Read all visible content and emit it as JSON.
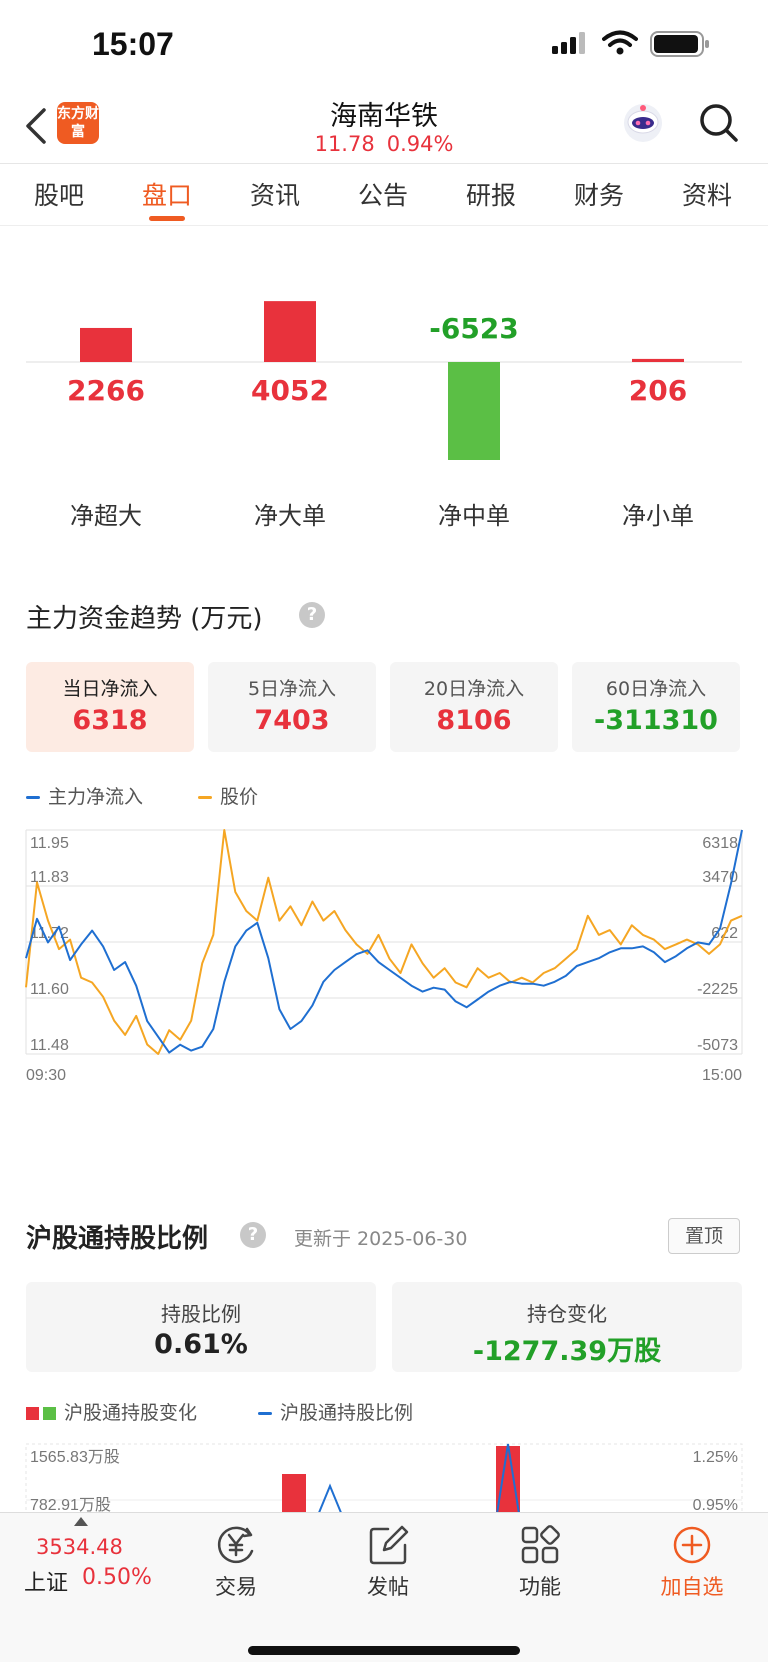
{
  "status_bar": {
    "time": "15:07"
  },
  "header": {
    "logo_text": "东方财富",
    "stock_name": "海南华铁",
    "price": "11.78",
    "change_pct": "0.94%"
  },
  "tabs": [
    {
      "label": "股吧",
      "active": false
    },
    {
      "label": "盘口",
      "active": true
    },
    {
      "label": "资讯",
      "active": false
    },
    {
      "label": "公告",
      "active": false
    },
    {
      "label": "研报",
      "active": false
    },
    {
      "label": "财务",
      "active": false
    },
    {
      "label": "资料",
      "active": false
    }
  ],
  "order_flow": [
    {
      "label": "净超大",
      "value": "2266",
      "amount": 2266
    },
    {
      "label": "净大单",
      "value": "4052",
      "amount": 4052
    },
    {
      "label": "净中单",
      "value": "-6523",
      "amount": -6523
    },
    {
      "label": "净小单",
      "value": "206",
      "amount": 206
    }
  ],
  "trend_section": {
    "title": "主力资金趋势 (万元)",
    "help_glyph": "?",
    "periods": [
      {
        "label": "当日净流入",
        "value": "6318",
        "active": true,
        "sign": "pos"
      },
      {
        "label": "5日净流入",
        "value": "7403",
        "active": false,
        "sign": "pos"
      },
      {
        "label": "20日净流入",
        "value": "8106",
        "active": false,
        "sign": "pos"
      },
      {
        "label": "60日净流入",
        "value": "-311310",
        "active": false,
        "sign": "neg"
      }
    ],
    "legend": {
      "series1": "主力净流入",
      "series2": "股价"
    },
    "x_start": "09:30",
    "x_end": "15:00"
  },
  "chart_data": {
    "type": "line",
    "x": [
      "09:30",
      "15:00"
    ],
    "left_axis_ticks": [
      "11.95",
      "11.83",
      "11.72",
      "11.60",
      "11.48"
    ],
    "right_axis_ticks": [
      "6318",
      "3470",
      "622",
      "-2225",
      "-5073"
    ],
    "ylim_price": [
      11.48,
      11.95
    ],
    "ylim_flow": [
      -5073,
      6318
    ],
    "series": [
      {
        "name": "主力净流入",
        "color": "#1f6fd1",
        "values": [
          -200,
          1800,
          600,
          1400,
          -300,
          500,
          1200,
          400,
          -800,
          -400,
          -1600,
          -3400,
          -4200,
          -5000,
          -4600,
          -4900,
          -4700,
          -3800,
          -1400,
          400,
          1200,
          1600,
          -200,
          -2800,
          -3800,
          -3400,
          -2600,
          -1400,
          -800,
          -400,
          0,
          200,
          -400,
          -800,
          -1200,
          -1600,
          -1900,
          -1700,
          -1800,
          -2400,
          -2700,
          -2300,
          -1900,
          -1600,
          -1400,
          -1500,
          -1500,
          -1600,
          -1400,
          -1100,
          -600,
          -400,
          -200,
          100,
          300,
          300,
          400,
          100,
          -400,
          -100,
          300,
          600,
          500,
          1300,
          3600,
          6318
        ]
      },
      {
        "name": "股价",
        "color": "#f5a623",
        "values": [
          11.62,
          11.84,
          11.76,
          11.7,
          11.72,
          11.64,
          11.63,
          11.6,
          11.55,
          11.52,
          11.56,
          11.5,
          11.48,
          11.53,
          11.51,
          11.55,
          11.67,
          11.73,
          11.95,
          11.82,
          11.78,
          11.76,
          11.85,
          11.76,
          11.79,
          11.75,
          11.8,
          11.76,
          11.78,
          11.74,
          11.71,
          11.69,
          11.73,
          11.68,
          11.65,
          11.71,
          11.67,
          11.64,
          11.66,
          11.63,
          11.62,
          11.66,
          11.64,
          11.65,
          11.63,
          11.64,
          11.63,
          11.65,
          11.66,
          11.68,
          11.7,
          11.77,
          11.73,
          11.74,
          11.71,
          11.75,
          11.73,
          11.72,
          11.7,
          11.71,
          11.72,
          11.71,
          11.69,
          11.71,
          11.76,
          11.77
        ]
      }
    ],
    "grid": true
  },
  "hk_section": {
    "title": "沪股通持股比例",
    "help_glyph": "?",
    "updated": "更新于 2025-06-30",
    "pin_label": "置顶",
    "hold_ratio_label": "持股比例",
    "hold_ratio_value": "0.61%",
    "hold_change_label": "持仓变化",
    "hold_change_value": "-1277.39万股",
    "legend": {
      "series1": "沪股通持股变化",
      "series2": "沪股通持股比例"
    },
    "left_ticks": [
      "1565.83万股",
      "782.91万股"
    ],
    "right_ticks": [
      "1.25%",
      "0.95%"
    ]
  },
  "bottom_bar": {
    "index_value": "3534.48",
    "index_name": "上证",
    "index_change": "0.50%",
    "items": [
      {
        "label": "交易",
        "icon": "yen-circle-icon"
      },
      {
        "label": "发帖",
        "icon": "edit-icon"
      },
      {
        "label": "功能",
        "icon": "grid-icon"
      },
      {
        "label": "加自选",
        "icon": "plus-circle-icon"
      }
    ]
  },
  "colors": {
    "accent": "#ef5b22",
    "up": "#e8323c",
    "down": "#22a028",
    "flow_line": "#1f6fd1",
    "price_line": "#f5a623",
    "bar_down": "#5bbf45"
  }
}
